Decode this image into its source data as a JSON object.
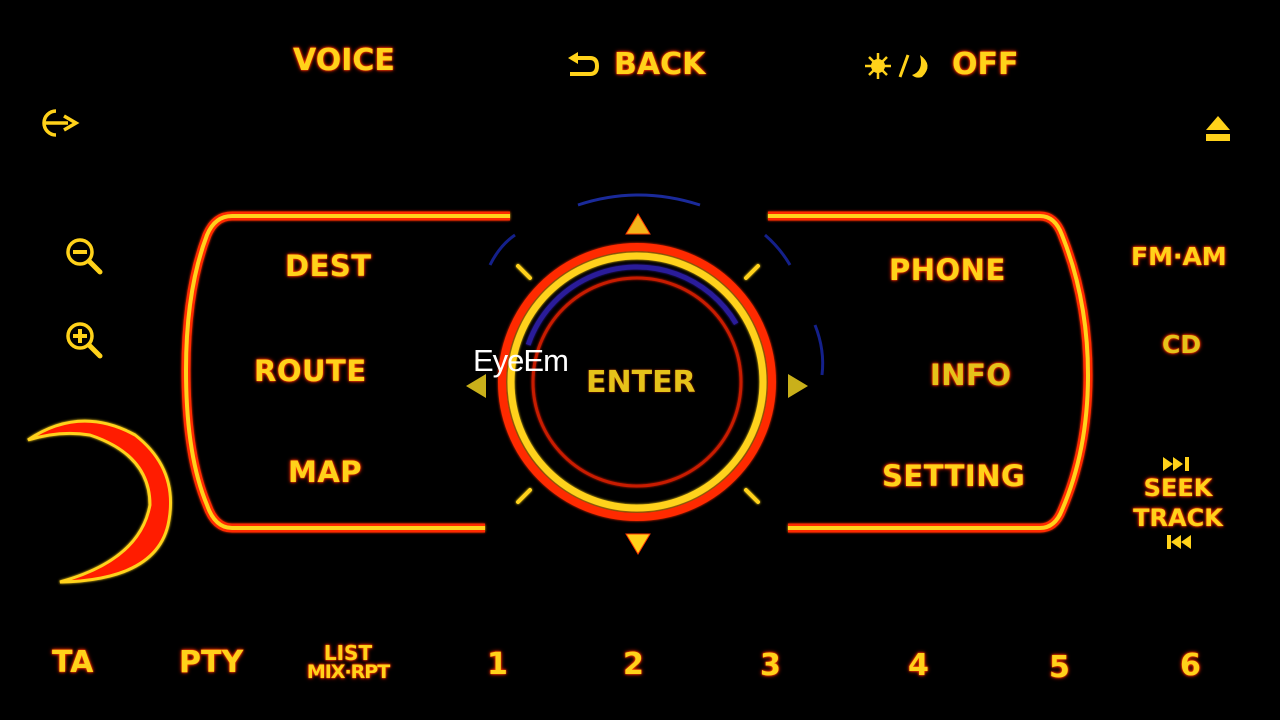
{
  "top_bar": {
    "voice_label": "VOICE",
    "back_label": "BACK",
    "back_icon": "return-arrow-icon",
    "display_label": "OFF",
    "display_icon": "sun-moon-icon"
  },
  "side_left": {
    "source_icon": "power-arrow-icon",
    "zoom_out_icon": "zoom-out-icon",
    "zoom_in_icon": "zoom-in-icon",
    "knob": "volume-knob"
  },
  "side_right": {
    "eject_icon": "eject-icon",
    "fm_am_label": "FM·AM",
    "cd_label": "CD",
    "seek_next_icon": "skip-forward-icon",
    "seek_label": "SEEK",
    "track_label": "TRACK",
    "seek_prev_icon": "skip-back-icon"
  },
  "nav_left": {
    "items": [
      {
        "label": "DEST"
      },
      {
        "label": "ROUTE"
      },
      {
        "label": "MAP"
      }
    ]
  },
  "nav_right": {
    "items": [
      {
        "label": "PHONE"
      },
      {
        "label": "INFO"
      },
      {
        "label": "SETTING"
      }
    ]
  },
  "controller": {
    "enter_label": "ENTER",
    "up_icon": "arrow-up-icon",
    "down_icon": "arrow-down-icon",
    "left_icon": "arrow-left-icon",
    "right_icon": "arrow-right-icon"
  },
  "bottom_bar": {
    "ta_label": "TA",
    "pty_label": "PTY",
    "list_label": "LIST",
    "mix_rpt_label": "MIX·RPT",
    "presets": [
      "1",
      "2",
      "3",
      "4",
      "5",
      "6"
    ]
  },
  "watermark": "EyeEm",
  "colors": {
    "glow_yellow": "#ffd21a",
    "glow_red": "#ff2a00",
    "accent_blue": "#1a2a9a",
    "background": "#000000"
  }
}
